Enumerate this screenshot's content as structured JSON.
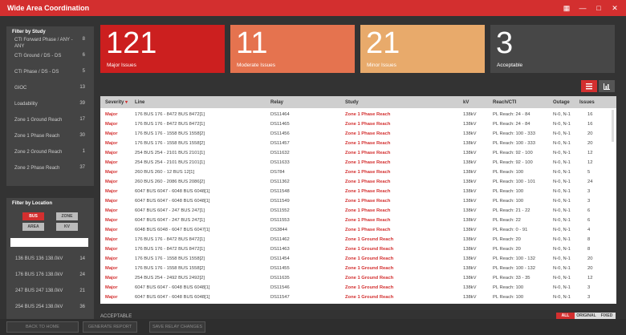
{
  "window": {
    "title": "Wide Area Coordination",
    "icons": [
      "grid-icon",
      "minimize-icon",
      "maximize-icon",
      "close-icon"
    ]
  },
  "filter_study": {
    "heading": "Filter by Study",
    "items": [
      {
        "label": "CTI Forward Phase / ANY - ANY",
        "count": "8"
      },
      {
        "label": "CTI Ground / DS - DS",
        "count": "6"
      },
      {
        "label": "CTI Phase / DS - DS",
        "count": "5"
      },
      {
        "label": "GIOC",
        "count": "13"
      },
      {
        "label": "Loadability",
        "count": "39"
      },
      {
        "label": "Zone 1 Ground Reach",
        "count": "17"
      },
      {
        "label": "Zone 1 Phase Reach",
        "count": "30"
      },
      {
        "label": "Zone 2 Ground Reach",
        "count": "1"
      },
      {
        "label": "Zone 2 Phase Reach",
        "count": "37"
      }
    ]
  },
  "filter_location": {
    "heading": "Filter by Location",
    "chips": [
      "BUS",
      "ZONE",
      "AREA",
      "KV"
    ],
    "search_value": "",
    "items": [
      {
        "label": "136 BUS 136 138.0kV",
        "count": "14"
      },
      {
        "label": "176 BUS 176 138.0kV",
        "count": "24"
      },
      {
        "label": "247 BUS 247 138.0kV",
        "count": "21"
      },
      {
        "label": "254 BUS 254 138.0kV",
        "count": "36"
      }
    ]
  },
  "cards": [
    {
      "number": "121",
      "label": "Major Issues",
      "color": "#cc1f1f"
    },
    {
      "number": "11",
      "label": "Moderate Issues",
      "color": "#e5734f"
    },
    {
      "number": "21",
      "label": "Minor Issues",
      "color": "#e8aa6b"
    },
    {
      "number": "3",
      "label": "Acceptable",
      "color": "#474747"
    }
  ],
  "view_toggle": {
    "list_icon": "list-icon",
    "chart_icon": "chart-icon"
  },
  "table": {
    "headers": [
      "Severity",
      "Line",
      "Relay",
      "Study",
      "kV",
      "Reach/CTI",
      "Outage",
      "Issues"
    ],
    "rows": [
      [
        "Major",
        "176 BUS 176 - 8472 BUS 8472[1]",
        "DS11464",
        "Zone 1 Phase Reach",
        "138kV",
        "PL Reach: 24 - 84",
        "N-0, N-1",
        "16"
      ],
      [
        "Major",
        "176 BUS 176 - 8472 BUS 8472[1]",
        "DS11465",
        "Zone 1 Phase Reach",
        "138kV",
        "PL Reach: 24 - 84",
        "N-0, N-1",
        "16"
      ],
      [
        "Major",
        "176 BUS 176 - 1558 BUS 1558[2]",
        "DS11456",
        "Zone 1 Phase Reach",
        "138kV",
        "PL Reach: 100 - 333",
        "N-0, N-1",
        "20"
      ],
      [
        "Major",
        "176 BUS 176 - 1558 BUS 1558[2]",
        "DS11457",
        "Zone 1 Phase Reach",
        "138kV",
        "PL Reach: 100 - 333",
        "N-0, N-1",
        "20"
      ],
      [
        "Major",
        "254 BUS 254 - 2101 BUS 2101[1]",
        "DS11632",
        "Zone 1 Phase Reach",
        "138kV",
        "PL Reach: 92 - 100",
        "N-0, N-1",
        "12"
      ],
      [
        "Major",
        "254 BUS 254 - 2101 BUS 2101[1]",
        "DS11633",
        "Zone 1 Phase Reach",
        "138kV",
        "PL Reach: 92 - 100",
        "N-0, N-1",
        "12"
      ],
      [
        "Major",
        "260 BUS 260 - 12 BUS 12[1]",
        "DS784",
        "Zone 1 Phase Reach",
        "138kV",
        "PL Reach: 100",
        "N-0, N-1",
        "5"
      ],
      [
        "Major",
        "260 BUS 260 - 2086 BUS 2086[2]",
        "DS11362",
        "Zone 1 Phase Reach",
        "138kV",
        "PL Reach: 100 - 101",
        "N-0, N-1",
        "24"
      ],
      [
        "Major",
        "6047 BUS 6047 - 6048 BUS 6048[1]",
        "DS11548",
        "Zone 1 Phase Reach",
        "138kV",
        "PL Reach: 100",
        "N-0, N-1",
        "3"
      ],
      [
        "Major",
        "6047 BUS 6047 - 6048 BUS 6048[1]",
        "DS11549",
        "Zone 1 Phase Reach",
        "138kV",
        "PL Reach: 100",
        "N-0, N-1",
        "3"
      ],
      [
        "Major",
        "6047 BUS 6047 - 247 BUS 247[1]",
        "DS11552",
        "Zone 1 Phase Reach",
        "138kV",
        "PL Reach: 21 - 22",
        "N-0, N-1",
        "6"
      ],
      [
        "Major",
        "6047 BUS 6047 - 247 BUS 247[1]",
        "DS11553",
        "Zone 1 Phase Reach",
        "138kV",
        "PL Reach: 22",
        "N-0, N-1",
        "6"
      ],
      [
        "Major",
        "6048 BUS 6048 - 6047 BUS 6047[1]",
        "DS3844",
        "Zone 1 Phase Reach",
        "138kV",
        "PL Reach: 0 - 91",
        "N-0, N-1",
        "4"
      ],
      [
        "Major",
        "176 BUS 176 - 8472 BUS 8472[1]",
        "DS11462",
        "Zone 1 Ground Reach",
        "138kV",
        "PL Reach: 20",
        "N-0, N-1",
        "8"
      ],
      [
        "Major",
        "176 BUS 176 - 8472 BUS 8472[1]",
        "DS11463",
        "Zone 1 Ground Reach",
        "138kV",
        "PL Reach: 20",
        "N-0, N-1",
        "8"
      ],
      [
        "Major",
        "176 BUS 176 - 1558 BUS 1558[2]",
        "DS11454",
        "Zone 1 Ground Reach",
        "138kV",
        "PL Reach: 100 - 132",
        "N-0, N-1",
        "20"
      ],
      [
        "Major",
        "176 BUS 176 - 1558 BUS 1558[2]",
        "DS11455",
        "Zone 1 Ground Reach",
        "138kV",
        "PL Reach: 100 - 132",
        "N-0, N-1",
        "20"
      ],
      [
        "Major",
        "254 BUS 254 - 2492 BUS 2492[2]",
        "DS11635",
        "Zone 1 Ground Reach",
        "138kV",
        "PL Reach: 33 - 35",
        "N-0, N-1",
        "12"
      ],
      [
        "Major",
        "6047 BUS 6047 - 6048 BUS 6048[1]",
        "DS11546",
        "Zone 1 Ground Reach",
        "138kV",
        "PL Reach: 100",
        "N-0, N-1",
        "3"
      ],
      [
        "Major",
        "6047 BUS 6047 - 6048 BUS 6048[1]",
        "DS11547",
        "Zone 1 Ground Reach",
        "138kV",
        "PL Reach: 100",
        "N-0, N-1",
        "3"
      ]
    ]
  },
  "acceptable_label": "ACCEPTABLE",
  "mini_tabs": [
    "ALL",
    "ORIGINAL",
    "FIXED"
  ],
  "bottom_buttons": [
    "BACK TO HOME",
    "GENERATE REPORT",
    "SAVE RELAY CHANGES"
  ]
}
